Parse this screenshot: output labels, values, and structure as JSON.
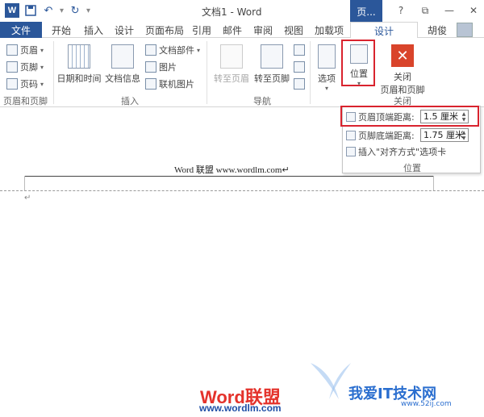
{
  "titlebar": {
    "logo_letter": "W",
    "doc_title": "文档1 - Word",
    "context_tab_group": "页...",
    "help": "?",
    "restore": "⧉",
    "minimize": "—",
    "close": "✕"
  },
  "tabs": {
    "file": "文件",
    "items": [
      "开始",
      "插入",
      "设计",
      "页面布局",
      "引用",
      "邮件",
      "审阅",
      "视图",
      "加载项"
    ],
    "active": "设计",
    "user": "胡俊"
  },
  "ribbon": {
    "header_footer": {
      "header": "页眉",
      "footer": "页脚",
      "page_number": "页码",
      "group_label": "页眉和页脚"
    },
    "insert": {
      "date_time": "日期和时间",
      "doc_info": "文档信息",
      "quick_parts": "文档部件",
      "pictures": "图片",
      "online_pictures": "联机图片",
      "group_label": "插入"
    },
    "navigation": {
      "goto_header": "转至页眉",
      "goto_footer": "转至页脚",
      "group_label": "导航"
    },
    "options": {
      "label": "选项"
    },
    "position": {
      "label": "位置"
    },
    "close": {
      "line1": "关闭",
      "line2": "页眉和页脚",
      "group_label": "关闭"
    }
  },
  "position_panel": {
    "header_distance_label": "页眉顶端距离:",
    "header_distance_value": "1.5 厘米",
    "footer_distance_label": "页脚底端距离:",
    "footer_distance_value": "1.75 厘米",
    "insert_alignment_tab": "插入\"对齐方式\"选项卡",
    "group_label": "位置"
  },
  "document": {
    "header_text": "Word 联盟  www.wordlm.com↵",
    "paragraph_mark": "↵"
  },
  "watermarks": {
    "logo_word": "Word",
    "logo_cn": "联盟",
    "logo_url": "www.wordlm.com",
    "right_text": "我爱IT技术网",
    "right_url": "www.52ij.com"
  },
  "colors": {
    "accent": "#2b579a",
    "highlight_box": "#d9232e",
    "close_button": "#d9442b"
  }
}
